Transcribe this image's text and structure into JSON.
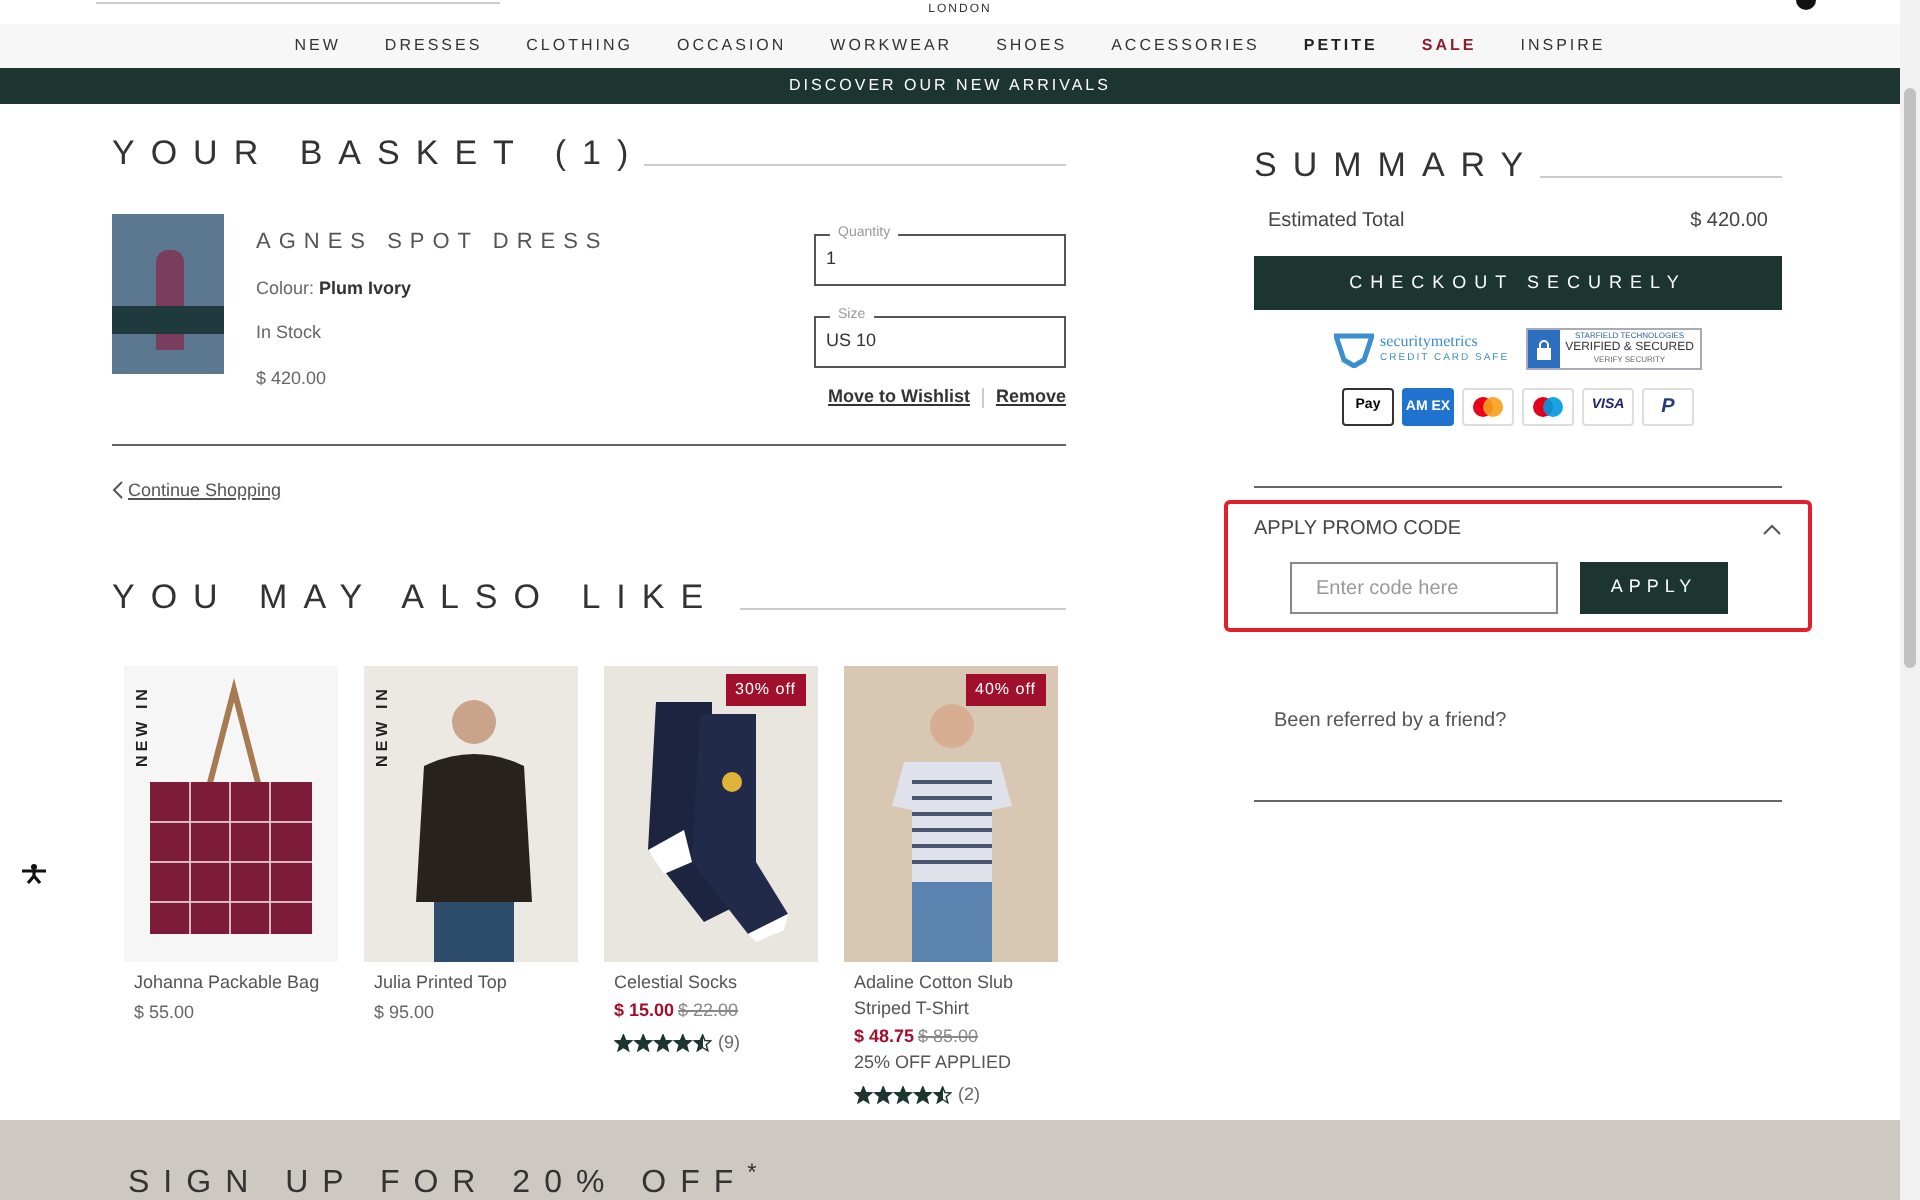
{
  "header": {
    "logo_subtitle": "LONDON"
  },
  "nav": [
    {
      "label": "NEW",
      "kind": "plain"
    },
    {
      "label": "DRESSES",
      "kind": "plain"
    },
    {
      "label": "CLOTHING",
      "kind": "plain"
    },
    {
      "label": "OCCASION",
      "kind": "plain"
    },
    {
      "label": "WORKWEAR",
      "kind": "plain"
    },
    {
      "label": "SHOES",
      "kind": "plain"
    },
    {
      "label": "ACCESSORIES",
      "kind": "plain"
    },
    {
      "label": "PETITE",
      "kind": "bold"
    },
    {
      "label": "SALE",
      "kind": "sale"
    },
    {
      "label": "INSPIRE",
      "kind": "plain"
    }
  ],
  "banner": "DISCOVER OUR NEW ARRIVALS",
  "basket": {
    "title": "YOUR BASKET (1)",
    "item": {
      "name": "AGNES SPOT DRESS",
      "colour_label": "Colour:",
      "colour": "Plum Ivory",
      "stock": "In Stock",
      "price": "$ 420.00",
      "quantity": {
        "label": "Quantity",
        "value": "1"
      },
      "size": {
        "label": "Size",
        "value": "US 10"
      },
      "actions": [
        "Move to Wishlist",
        "Remove"
      ]
    },
    "continue": "Continue Shopping"
  },
  "recommendations": {
    "title": "YOU MAY ALSO LIKE",
    "products": [
      {
        "name": "Johanna Packable Bag",
        "tag": "NEW IN",
        "price": "$ 55.00"
      },
      {
        "name": "Julia Printed Top",
        "tag": "NEW IN",
        "price": "$ 95.00"
      },
      {
        "name": "Celestial Socks",
        "badge": "30% off",
        "sale_price": "$ 15.00",
        "original_price": "$ 22.00",
        "stars": 4.5,
        "reviews": "(9)"
      },
      {
        "name": "Adaline Cotton Slub Striped T-Shirt",
        "badge": "40% off",
        "sale_price": "$ 48.75",
        "original_price": "$ 85.00",
        "note": "25% OFF APPLIED",
        "stars": 4.5,
        "reviews": "(2)"
      }
    ]
  },
  "summary": {
    "title": "SUMMARY",
    "total_label": "Estimated Total",
    "total": "$ 420.00",
    "checkout": "CHECKOUT SECURELY",
    "trust_badges": [
      {
        "kind": "securitymetrics",
        "title": "securitymetrics",
        "subtitle": "CREDIT CARD SAFE"
      },
      {
        "kind": "starfield",
        "title": "STARFIELD TECHNOLOGIES",
        "subtitle": "VERIFIED & SECURED",
        "caption": "VERIFY SECURITY"
      }
    ],
    "payments": [
      {
        "kind": "applepay",
        "label": "Pay"
      },
      {
        "kind": "amex",
        "label": "AM EX"
      },
      {
        "kind": "mastercard"
      },
      {
        "kind": "maestro"
      },
      {
        "kind": "visa",
        "label": "VISA"
      },
      {
        "kind": "paypal",
        "label": "P"
      }
    ],
    "promo": {
      "title": "APPLY PROMO CODE",
      "expanded": true,
      "placeholder": "Enter code here",
      "button": "APPLY"
    },
    "referral": "Been referred by a friend?"
  },
  "footer": {
    "signup": "SIGN UP FOR 20% OFF$^{*}$"
  }
}
